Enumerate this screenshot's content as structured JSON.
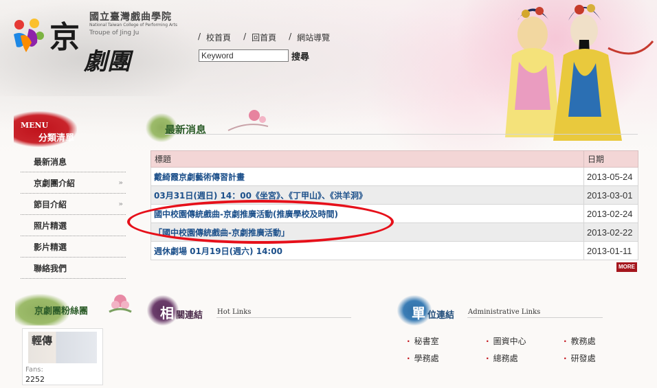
{
  "header": {
    "school_name": "國立臺灣戲曲學院",
    "school_name_en": "National Taiwan College of Performing Arts",
    "troupe_en": "Troupe of Jing Ju",
    "logo_big_char": "京",
    "logo_small_chars": "劇團"
  },
  "topnav": {
    "items": [
      "校首頁",
      "回首頁",
      "網站導覽"
    ],
    "separator": "/"
  },
  "search": {
    "value": "Keyword",
    "button_label": "搜尋"
  },
  "sidebar": {
    "menu_en": "MENU",
    "menu_title": "分類清單",
    "items": [
      {
        "label": "最新消息",
        "has_arrow": false
      },
      {
        "label": "京劇團介紹",
        "has_arrow": true
      },
      {
        "label": "節目介紹",
        "has_arrow": true
      },
      {
        "label": "照片精選",
        "has_arrow": false
      },
      {
        "label": "影片精選",
        "has_arrow": false
      },
      {
        "label": "聯絡我們",
        "has_arrow": false
      }
    ],
    "arrow_glyph": "»",
    "fans": {
      "title": "京劇團粉絲團",
      "label": "Fans:",
      "count": "2252",
      "thumb_text": "輕傳"
    }
  },
  "news": {
    "section_title": "最新消息",
    "col_title": "標題",
    "col_date": "日期",
    "rows": [
      {
        "title": "戴綺霞京劇藝術傳習計畫",
        "date": "2013-05-24"
      },
      {
        "title": "03月31日(週日) 14：00《坐宮》、《丁甲山》、《洪羊洞》",
        "date": "2013-03-01"
      },
      {
        "title": "國中校園傳統戲曲-京劇推廣活動(推廣學校及時間)",
        "date": "2013-02-24"
      },
      {
        "title": "「國中校園傳統戲曲-京劇推廣活動」",
        "date": "2013-02-22"
      },
      {
        "title": "週休劇場 01月19日(週六) 14:00",
        "date": "2013-01-11"
      }
    ],
    "more_label": "MORE"
  },
  "hot_links": {
    "big_char": "相",
    "title_rest": "關連結",
    "title_en": "Hot Links"
  },
  "admin_links": {
    "big_char": "單",
    "title_rest": "位連結",
    "title_en": "Administrative Links",
    "items": [
      "秘書室",
      "圖資中心",
      "教務處",
      "學務處",
      "總務處",
      "研發處"
    ]
  },
  "colors": {
    "brand_red": "#c4161e",
    "link_blue": "#1b4f8a",
    "section_green": "#2d5d2a",
    "annotation_red": "#e6101a"
  }
}
